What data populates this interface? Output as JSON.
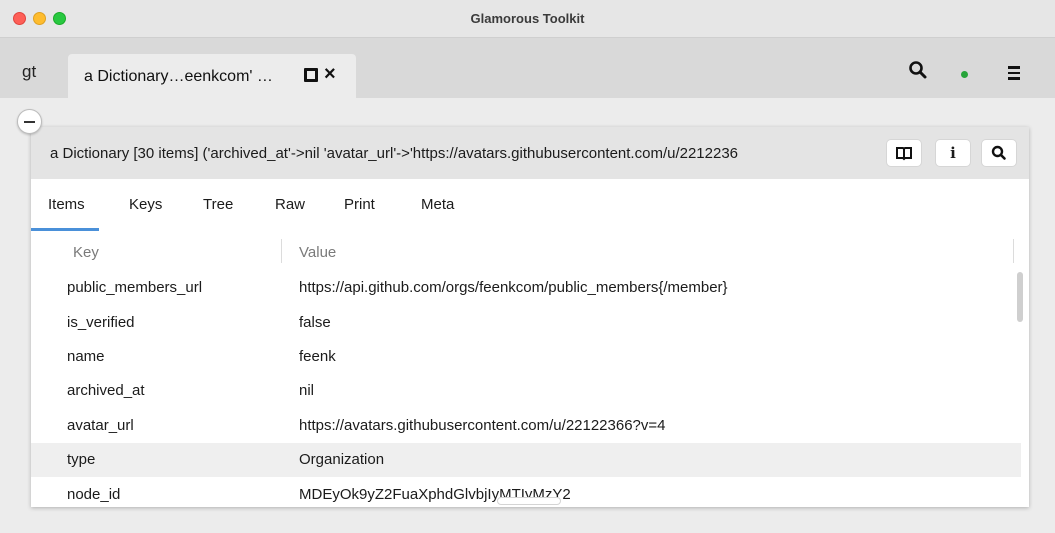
{
  "window": {
    "title": "Glamorous Toolkit"
  },
  "tabstrip": {
    "logo": "gt",
    "tab": {
      "label": "a Dictionary…eenkcom' …"
    }
  },
  "inspector": {
    "title": "a Dictionary [30 items] ('archived_at'->nil 'avatar_url'->'https://avatars.githubusercontent.com/u/2212236",
    "info_label": "i",
    "views": [
      "Items",
      "Keys",
      "Tree",
      "Raw",
      "Print",
      "Meta"
    ],
    "active_view": "Items",
    "columns": {
      "key": "Key",
      "value": "Value"
    },
    "rows": [
      {
        "key": "public_members_url",
        "value": "https://api.github.com/orgs/feenkcom/public_members{/member}"
      },
      {
        "key": "is_verified",
        "value": "false"
      },
      {
        "key": "name",
        "value": "feenk"
      },
      {
        "key": "archived_at",
        "value": "nil"
      },
      {
        "key": "avatar_url",
        "value": "https://avatars.githubusercontent.com/u/22122366?v=4"
      },
      {
        "key": "type",
        "value": "Organization"
      },
      {
        "key": "node_id",
        "value": "MDEyOk9yZ2FuaXphdGlvbjIyMTIyMzY2"
      }
    ],
    "selected_row": 5
  },
  "colors": {
    "accent": "#4a90d9",
    "status_dot": "#27a43a"
  }
}
